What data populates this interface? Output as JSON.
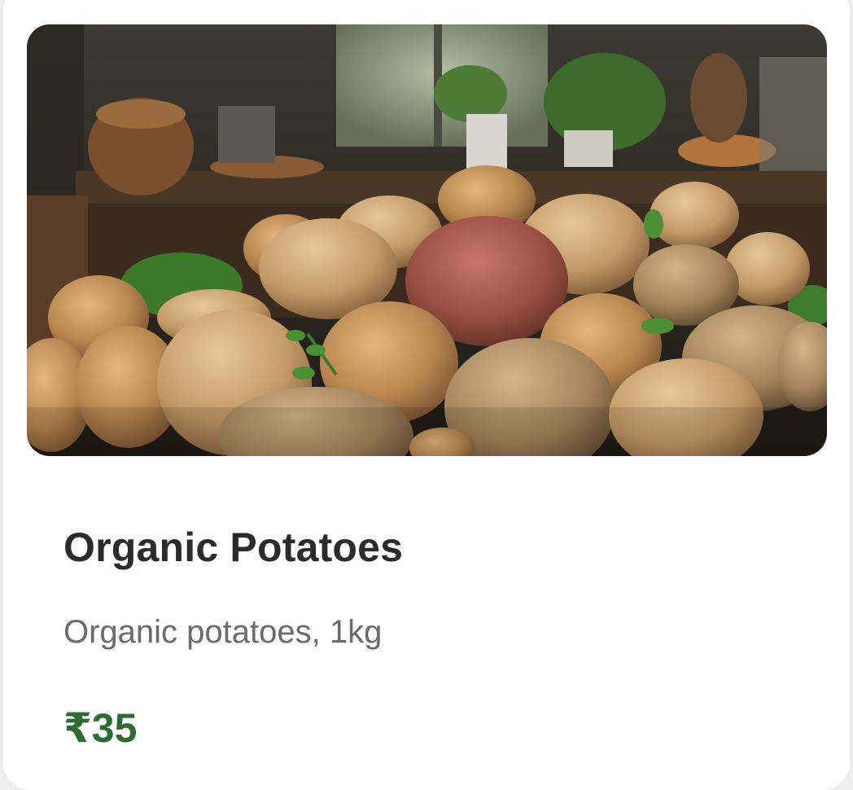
{
  "product": {
    "image_alt": "Pile of organic potatoes on a kitchen table",
    "name": "Organic Potatoes",
    "description": "Organic potatoes, 1kg",
    "price": "₹35"
  },
  "colors": {
    "card_background": "#ffffff",
    "title": "#2b2b2b",
    "description": "#6b6b6b",
    "price": "#2e6b35"
  }
}
